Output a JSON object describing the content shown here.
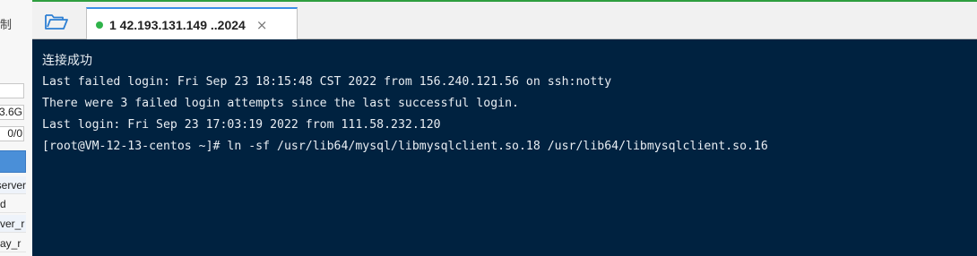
{
  "left_panel": {
    "label": "制",
    "fields": [
      "",
      "3.6G",
      "0/0"
    ],
    "list_items": [
      "server",
      "d",
      "ver_r",
      "ay_r"
    ]
  },
  "tabbar": {
    "active_tab": {
      "label": "1 42.193.131.149 ..2024",
      "status_color": "#2fb34a",
      "close_glyph": "×"
    }
  },
  "terminal": {
    "background": "#002240",
    "lines": [
      "连接成功",
      "Last failed login: Fri Sep 23 18:15:48 CST 2022 from 156.240.121.56 on ssh:notty",
      "There were 3 failed login attempts since the last successful login.",
      "Last login: Fri Sep 23 17:03:19 2022 from 111.58.232.120",
      "[root@VM-12-13-centos ~]# ln -sf /usr/lib64/mysql/libmysqlclient.so.18 /usr/lib64/libmysqlclient.so.16"
    ]
  }
}
